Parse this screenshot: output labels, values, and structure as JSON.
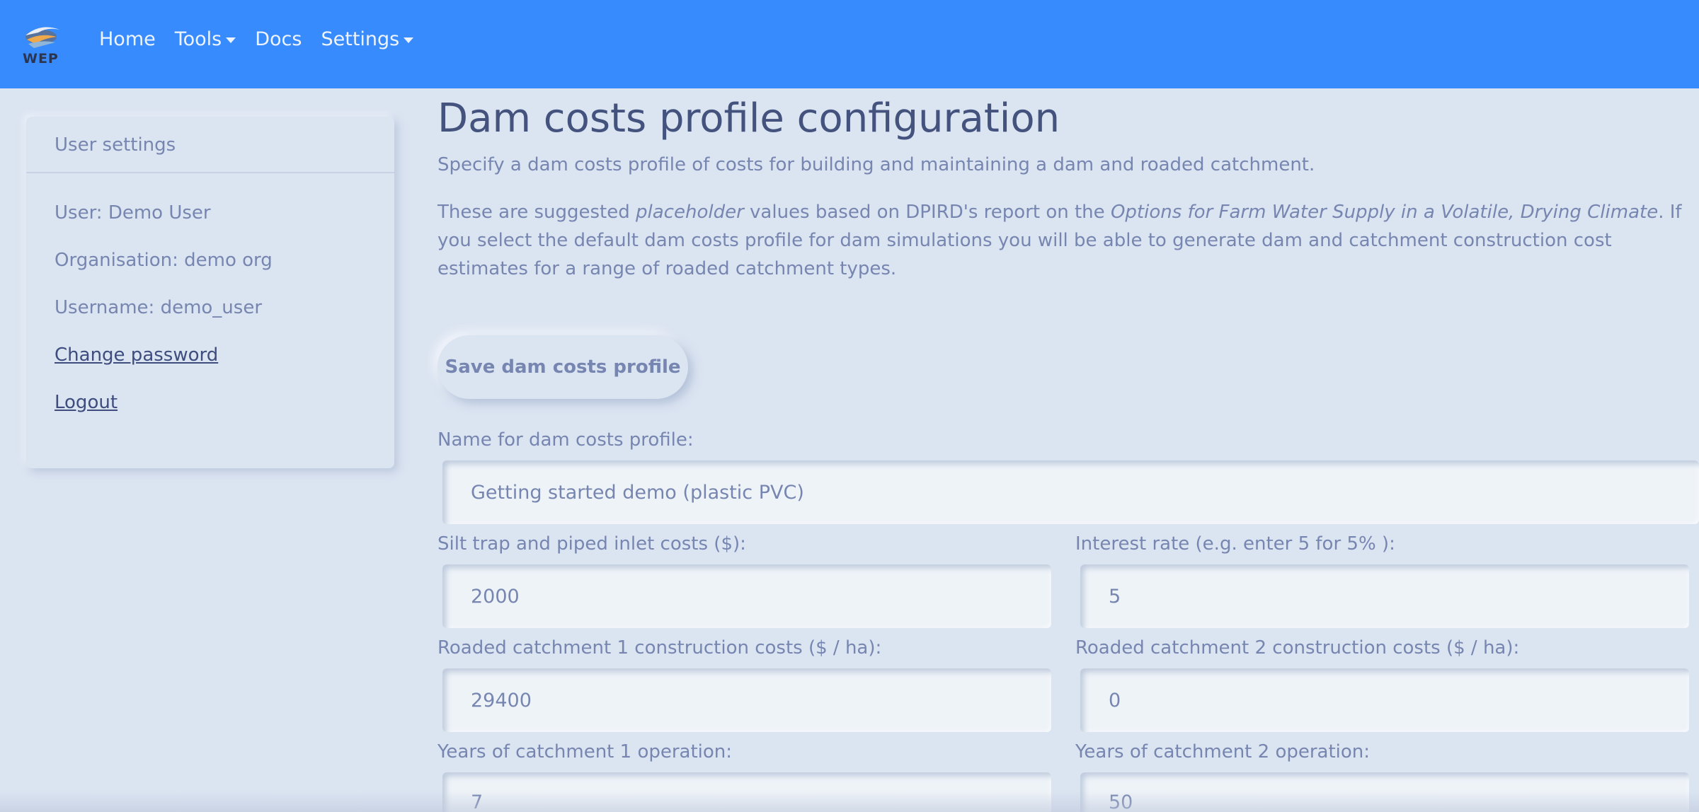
{
  "brand": {
    "logo_text": "WEP"
  },
  "nav": {
    "home": "Home",
    "tools": "Tools",
    "docs": "Docs",
    "settings": "Settings"
  },
  "sidebar": {
    "header": "User settings",
    "user": "User: Demo User",
    "organisation": "Organisation: demo org",
    "username": "Username: demo_user",
    "change_password": "Change password",
    "logout": "Logout"
  },
  "main": {
    "title": "Dam costs profile configuration",
    "lead": "Specify a dam costs profile of costs for building and maintaining a dam and roaded catchment.",
    "para": {
      "part1": "These are suggested ",
      "em1": "placeholder",
      "part2": " values based on DPIRD's report on the ",
      "em2": "Options for Farm Water Supply in a Volatile, Drying Climate",
      "part3": ". If you select the default dam costs profile for dam simulations you will be able to generate dam and catchment construction cost estimates for a range of roaded catchment types."
    },
    "save_button": "Save dam costs profile"
  },
  "form": {
    "name_label": "Name for dam costs profile:",
    "name_value": "Getting started demo (plastic PVC)",
    "silt_label": "Silt trap and piped inlet costs ($):",
    "silt_value": "2000",
    "interest_label": "Interest rate (e.g. enter 5 for 5% ):",
    "interest_value": "5",
    "rc1_label": "Roaded catchment 1 construction costs ($ / ha):",
    "rc1_value": "29400",
    "rc2_label": "Roaded catchment 2 construction costs ($ / ha):",
    "rc2_value": "0",
    "years1_label": "Years of catchment 1 operation:",
    "years1_value": "7",
    "years2_label": "Years of catchment 2 operation:",
    "years2_value": "50"
  },
  "colors": {
    "navbar": "#388bfd",
    "background": "#dbe4f1",
    "text": "#7786b0",
    "title": "#44527e"
  }
}
